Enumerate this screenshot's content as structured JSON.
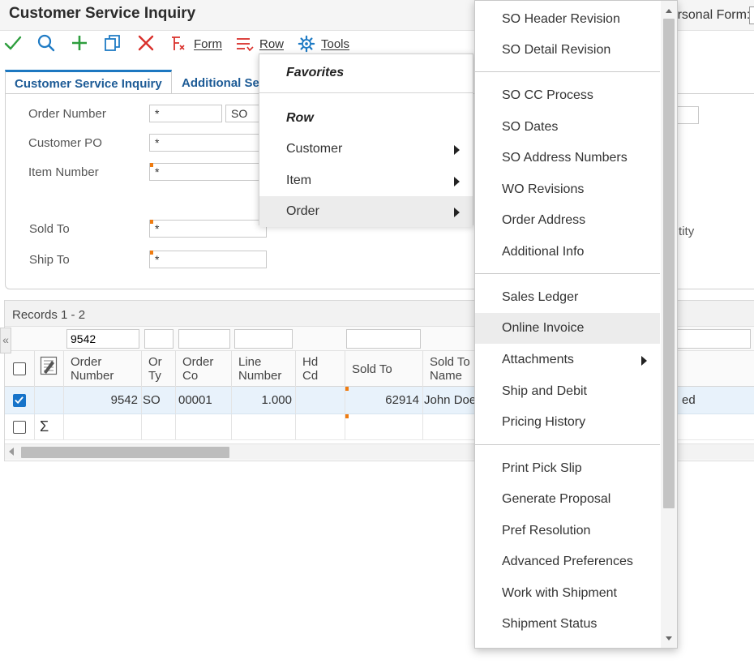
{
  "app": {
    "title": "Customer Service Inquiry",
    "personal_form_label": "Personal Form:"
  },
  "toolbar": {
    "form_label": "Form",
    "row_label": "Row",
    "tools_label": "Tools"
  },
  "tabs": [
    {
      "label": "Customer Service Inquiry"
    },
    {
      "label": "Additional Se"
    }
  ],
  "form": {
    "order_number_label": "Order Number",
    "order_number_value": "*",
    "order_type_value": "SO",
    "customer_po_label": "Customer PO",
    "customer_po_value": "*",
    "item_number_label": "Item Number",
    "item_number_value": "*",
    "sold_to_label": "Sold To",
    "sold_to_value": "*",
    "ship_to_label": "Ship To",
    "ship_to_value": "*",
    "partial_quantity_label": "uantity"
  },
  "grid": {
    "records_text": "Records 1 - 2",
    "qbe_order_number": "9542",
    "headers": [
      "Order\nNumber",
      "Or\nTy",
      "Order\nCo",
      "Line\nNumber",
      "Hd\nCd",
      "Sold To",
      "Sold To\nName"
    ],
    "row": {
      "order_number": "9542",
      "or_ty": "SO",
      "order_co": "00001",
      "line_number": "1.000",
      "sold_to": "62914",
      "sold_to_name": "John Doe",
      "partial_status": "ed"
    },
    "sum_icon": "Σ"
  },
  "row_menu": {
    "favorites_label": "Favorites",
    "row_label": "Row",
    "items": [
      {
        "label": "Customer"
      },
      {
        "label": "Item"
      },
      {
        "label": "Order"
      }
    ]
  },
  "order_submenu": {
    "items": [
      {
        "label": "SO Header Revision"
      },
      {
        "label": "SO Detail Revision"
      },
      {
        "label": "SO CC Process"
      },
      {
        "label": "SO Dates"
      },
      {
        "label": "SO Address Numbers"
      },
      {
        "label": "WO Revisions"
      },
      {
        "label": "Order Address"
      },
      {
        "label": "Additional Info"
      },
      {
        "label": "Sales Ledger"
      },
      {
        "label": "Online Invoice"
      },
      {
        "label": "Attachments"
      },
      {
        "label": "Ship and Debit"
      },
      {
        "label": "Pricing History"
      },
      {
        "label": "Print Pick Slip"
      },
      {
        "label": "Generate Proposal"
      },
      {
        "label": "Pref Resolution"
      },
      {
        "label": "Advanced Preferences"
      },
      {
        "label": "Work with Shipment"
      },
      {
        "label": "Shipment Status"
      }
    ]
  },
  "colors": {
    "accent_blue": "#1d5b96",
    "ok_green": "#2e9e3e",
    "cancel_red": "#d9302b",
    "required_orange": "#ef7b10",
    "selected_row": "#e8f2fb",
    "menu_highlight": "#ececec"
  },
  "icons": [
    "check-icon",
    "search-icon",
    "plus-icon",
    "copy-icon",
    "close-icon",
    "form-icon",
    "row-icon",
    "tools-gear-icon",
    "chevron-right-icon",
    "sum-icon",
    "grid-settings-icon"
  ]
}
